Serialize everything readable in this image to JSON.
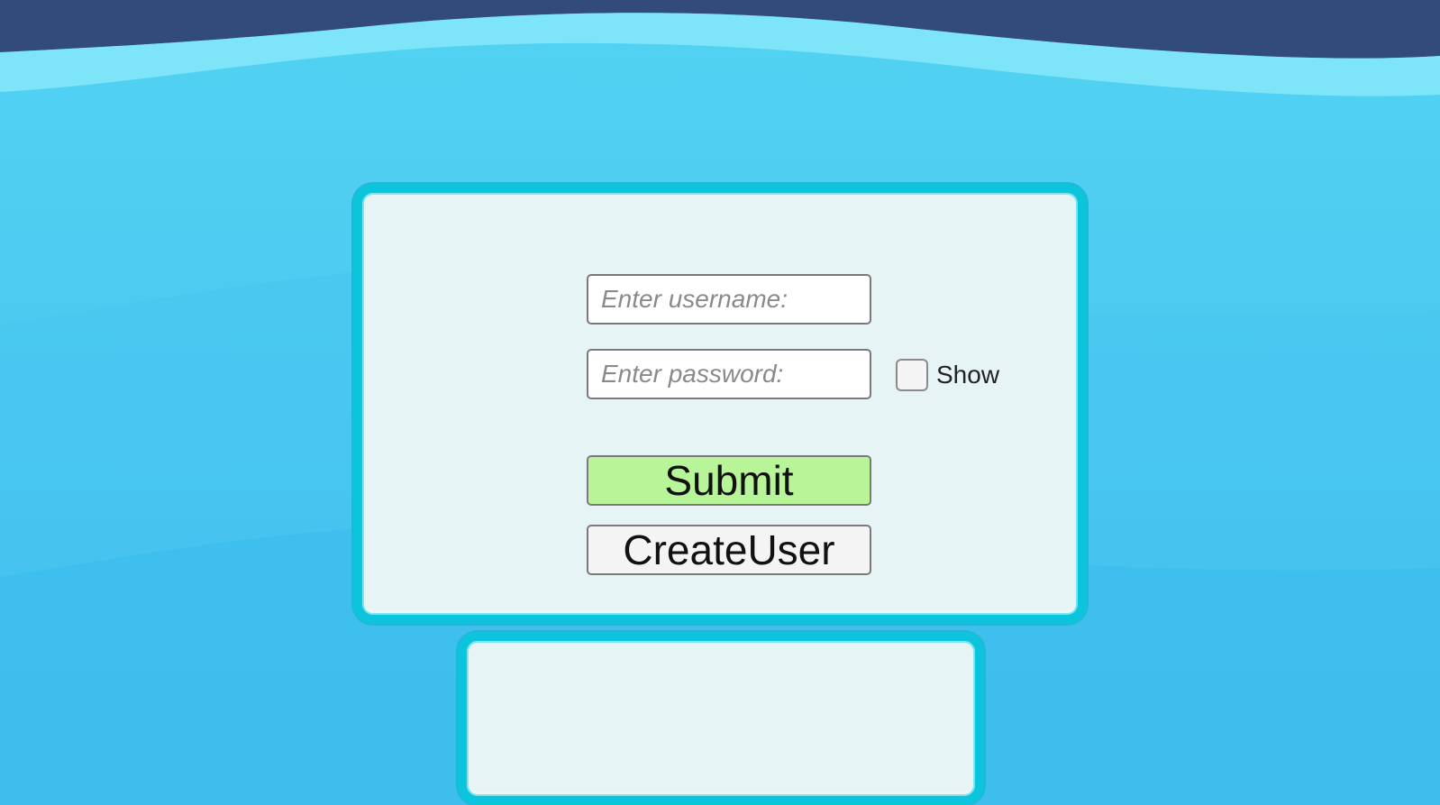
{
  "login_form": {
    "username_placeholder": "Enter username:",
    "username_value": "",
    "password_placeholder": "Enter password:",
    "password_value": "",
    "show_checkbox_label": "Show",
    "show_checked": false,
    "submit_label": "Submit",
    "create_user_label": "CreateUser"
  },
  "message_panel": {
    "text": ""
  },
  "colors": {
    "background_sky": "#4cc9f0",
    "top_band": "#324b7a",
    "wave_highlight": "#86e8f8",
    "panel_border": "#0cc4dc",
    "panel_fill": "#e6f4f5",
    "submit_fill": "#b8f599"
  }
}
